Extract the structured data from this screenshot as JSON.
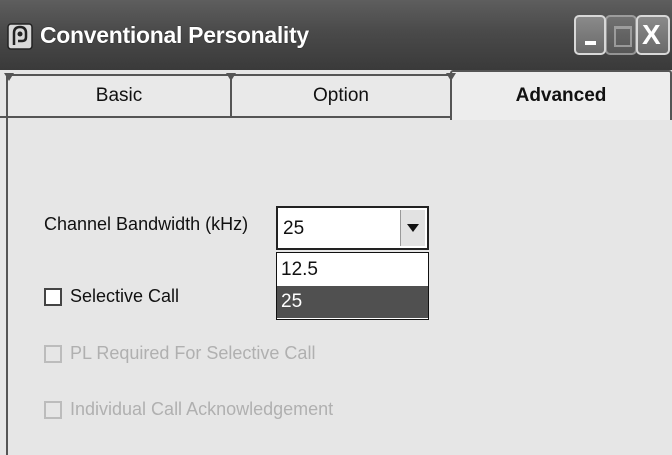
{
  "window": {
    "title": "Conventional Personality",
    "icon": "app-icon",
    "controls": {
      "minimize": "minimize-icon",
      "maximize": "maximize-icon",
      "close_label": "X"
    }
  },
  "tabs": [
    {
      "label": "Basic",
      "selected": false
    },
    {
      "label": "Option",
      "selected": false
    },
    {
      "label": "Advanced",
      "selected": true
    }
  ],
  "advanced": {
    "channel_bandwidth": {
      "label": "Channel Bandwidth (kHz)",
      "value": "25",
      "options": [
        "12.5",
        "25"
      ],
      "highlighted": "25"
    },
    "checkboxes": [
      {
        "label": "Selective Call",
        "checked": false,
        "enabled": true
      },
      {
        "label": "PL Required For Selective Call",
        "checked": false,
        "enabled": false
      },
      {
        "label": "Individual Call Acknowledgement",
        "checked": false,
        "enabled": false
      }
    ]
  },
  "colors": {
    "titlebar": "#4a4a4a",
    "highlight": "#505050",
    "disabled_text": "#b0b0b0"
  }
}
